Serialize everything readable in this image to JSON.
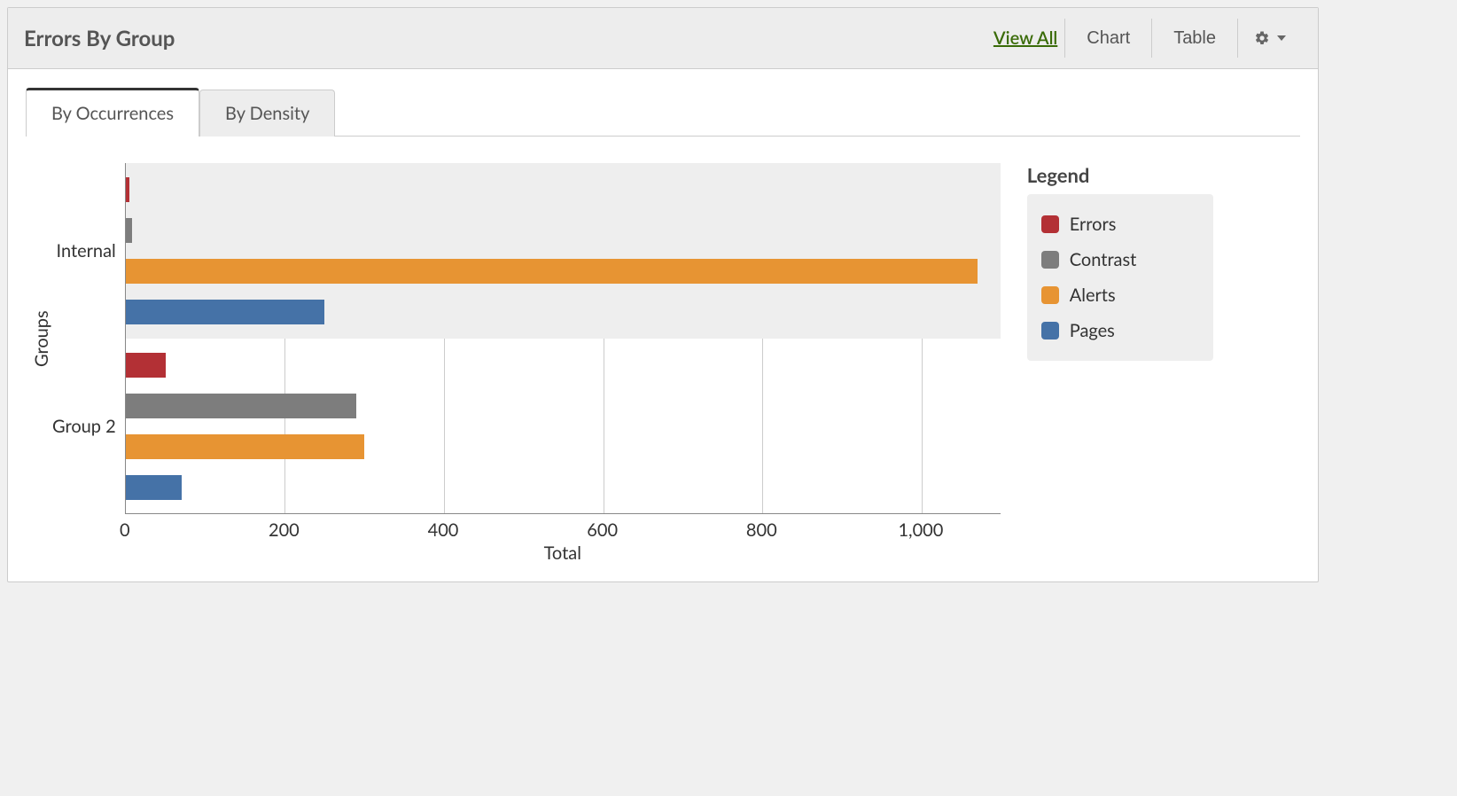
{
  "header": {
    "title": "Errors By Group",
    "view_all": "View All",
    "chart_btn": "Chart",
    "table_btn": "Table"
  },
  "tabs": {
    "by_occurrences": "By Occurrences",
    "by_density": "By Density",
    "active": "by_occurrences"
  },
  "axes": {
    "y_title": "Groups",
    "x_title": "Total"
  },
  "legend": {
    "title": "Legend",
    "items": [
      {
        "key": "errors",
        "label": "Errors",
        "color": "#b33035"
      },
      {
        "key": "contrast",
        "label": "Contrast",
        "color": "#7d7d7d"
      },
      {
        "key": "alerts",
        "label": "Alerts",
        "color": "#e79433"
      },
      {
        "key": "pages",
        "label": "Pages",
        "color": "#4572a7"
      }
    ]
  },
  "chart_data": {
    "type": "bar",
    "orientation": "horizontal",
    "grouped": true,
    "categories": [
      "Internal",
      "Group 2"
    ],
    "series": [
      {
        "name": "Errors",
        "values": [
          5,
          50
        ]
      },
      {
        "name": "Contrast",
        "values": [
          8,
          290
        ]
      },
      {
        "name": "Alerts",
        "values": [
          1070,
          300
        ]
      },
      {
        "name": "Pages",
        "values": [
          250,
          70
        ]
      }
    ],
    "title": "Errors By Group",
    "xlabel": "Total",
    "ylabel": "Groups",
    "xlim": [
      0,
      1100
    ],
    "x_ticks": [
      0,
      200,
      400,
      600,
      800,
      1000
    ],
    "x_tick_labels": [
      "0",
      "200",
      "400",
      "600",
      "800",
      "1,000"
    ]
  }
}
